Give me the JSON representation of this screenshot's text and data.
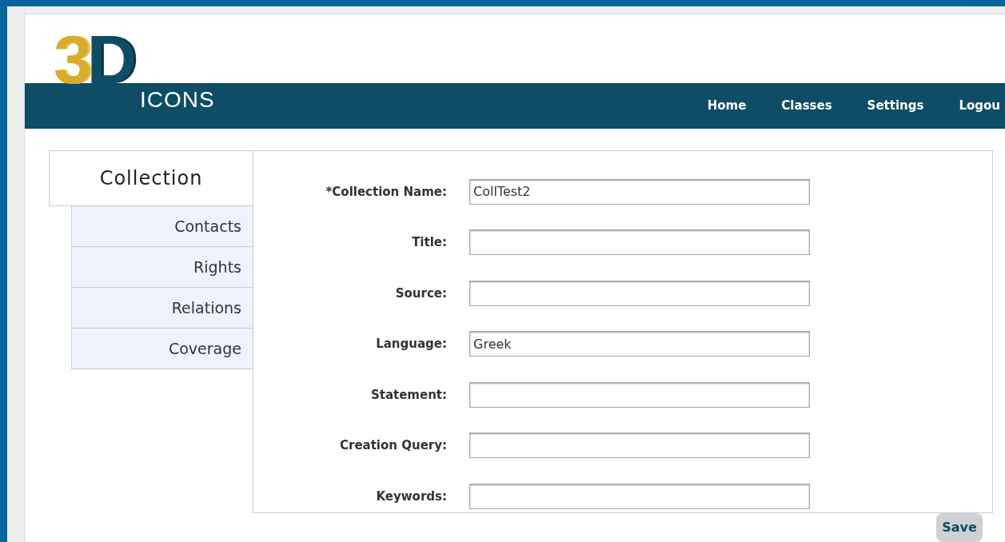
{
  "logo": {
    "digit": "3",
    "letter": "D",
    "word": "ICONS"
  },
  "nav": [
    "Home",
    "Classes",
    "Settings",
    "Logou"
  ],
  "tabs": [
    {
      "label": "Collection",
      "selected": true
    },
    {
      "label": "Contacts",
      "selected": false
    },
    {
      "label": "Rights",
      "selected": false
    },
    {
      "label": "Relations",
      "selected": false
    },
    {
      "label": "Coverage",
      "selected": false
    }
  ],
  "fields": [
    {
      "label": "*Collection Name:",
      "value": "CollTest2"
    },
    {
      "label": "Title:"
    },
    {
      "label": "Source:"
    },
    {
      "label": "Language:",
      "value": "Greek"
    },
    {
      "label": "Statement:"
    },
    {
      "label": "Creation Query:"
    },
    {
      "label": "Keywords:"
    }
  ],
  "save_button": "Save"
}
